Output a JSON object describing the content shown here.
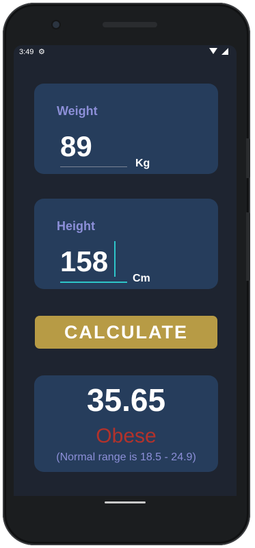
{
  "status_bar": {
    "time": "3:49",
    "gear_icon": "settings-gear-icon",
    "wifi_icon": "wifi-icon",
    "signal_icon": "cell-signal-icon"
  },
  "weight": {
    "label": "Weight",
    "value": "89",
    "unit": "Kg"
  },
  "height": {
    "label": "Height",
    "value": "158",
    "unit": "Cm"
  },
  "calculate_button": {
    "label": "CALCULATE"
  },
  "result": {
    "bmi": "35.65",
    "category": "Obese",
    "normal_range": "(Normal range is 18.5 - 24.9)"
  },
  "colors": {
    "background": "#1e2430",
    "card": "#263d5c",
    "label": "#8c8fd8",
    "accent": "#2ec5c9",
    "button": "#b79b45",
    "category_obese": "#b3322b"
  }
}
